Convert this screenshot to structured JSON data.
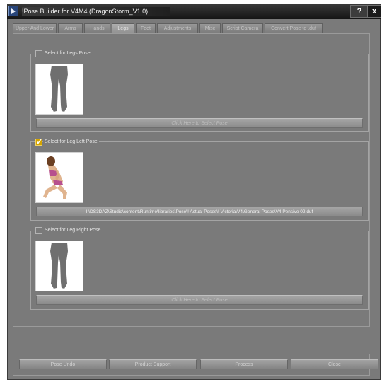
{
  "window": {
    "title": "!Pose Builder for V4M4 (DragonStorm_V1.0)"
  },
  "titlebar_buttons": {
    "help": "?",
    "close": "x"
  },
  "tabs": [
    {
      "label": "Upper And Lower"
    },
    {
      "label": "Arms"
    },
    {
      "label": "Hands"
    },
    {
      "label": "Legs",
      "active": true
    },
    {
      "label": "Feet"
    },
    {
      "label": "Adjustments"
    },
    {
      "label": "Misc"
    },
    {
      "label": "Script Camera"
    },
    {
      "label": "Convert Pose to .duf"
    }
  ],
  "sections": [
    {
      "label": "Select for Legs Pose",
      "checked": false,
      "button_text": "Click Here to Select Pose"
    },
    {
      "label": "Select for Leg Left Pose",
      "checked": true,
      "button_text": "I:\\DS3DAZ\\Studio\\content\\Runtime\\libraries\\Pose\\! Actual Poses\\! Victoria\\V4\\General Poses\\V4 Pensive 02.duf"
    },
    {
      "label": "Select for Leg Right Pose",
      "checked": false,
      "button_text": "Click Here to Select Pose"
    }
  ],
  "actions": [
    {
      "label": "Pose Undo"
    },
    {
      "label": "Product Support"
    },
    {
      "label": "Process"
    },
    {
      "label": "Close"
    }
  ],
  "colors": {
    "window_bg": "#7a7a7a",
    "titlebar": "#151515",
    "checkbox_checked": "#d4a400",
    "figure": "#6f6f6f",
    "skin": "#e0b48f",
    "swimsuit": "#b7508e"
  },
  "icons": {
    "app": "play-triangle-icon",
    "legs_thumbnail": "legs-figure-icon",
    "pose_thumbnail": "seated-figure-icon"
  }
}
